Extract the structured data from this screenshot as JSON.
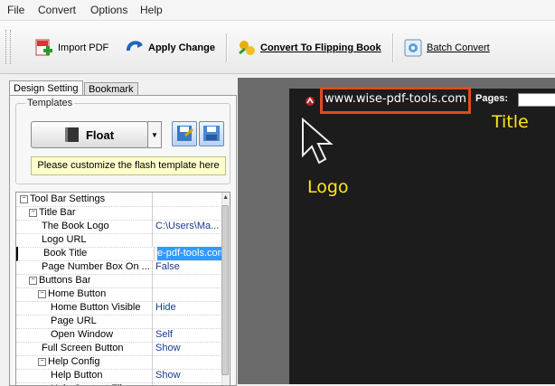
{
  "menu": [
    "File",
    "Convert",
    "Options",
    "Help"
  ],
  "toolbar": {
    "import_label": "Import PDF",
    "apply_label": "Apply Change",
    "convert_label": "Convert To Flipping Book",
    "batch_label": "Batch Convert"
  },
  "tabs": [
    "Design Setting",
    "Bookmark"
  ],
  "templates": {
    "group_label": "Templates",
    "selected": "Float",
    "hint": "Please customize the flash template here"
  },
  "property_grid": [
    {
      "name": "Tool Bar Settings",
      "indent": 0,
      "group": true,
      "value": ""
    },
    {
      "name": "Title Bar",
      "indent": 1,
      "group": true,
      "value": ""
    },
    {
      "name": "The Book Logo",
      "indent": 2,
      "group": false,
      "value": "C:\\Users\\Ma..."
    },
    {
      "name": "Logo URL",
      "indent": 2,
      "group": false,
      "value": ""
    },
    {
      "name": "Book Title",
      "indent": 2,
      "group": false,
      "value": "e-pdf-tools.com",
      "selected": true
    },
    {
      "name": "Page Number Box On ...",
      "indent": 2,
      "group": false,
      "value": "False"
    },
    {
      "name": "Buttons Bar",
      "indent": 1,
      "group": true,
      "value": ""
    },
    {
      "name": "Home Button",
      "indent": 2,
      "group": true,
      "value": ""
    },
    {
      "name": "Home Button Visible",
      "indent": 3,
      "group": false,
      "value": "Hide"
    },
    {
      "name": "Page URL",
      "indent": 3,
      "group": false,
      "value": ""
    },
    {
      "name": "Open Window",
      "indent": 3,
      "group": false,
      "value": "Self"
    },
    {
      "name": "Full Screen Button",
      "indent": 2,
      "group": false,
      "value": "Show"
    },
    {
      "name": "Help Config",
      "indent": 2,
      "group": true,
      "value": ""
    },
    {
      "name": "Help Button",
      "indent": 3,
      "group": false,
      "value": "Show"
    },
    {
      "name": "Help Content File",
      "indent": 3,
      "group": false,
      "value": ""
    }
  ],
  "preview": {
    "url_text": "www.wise-pdf-tools.com",
    "pages_label": "Pages:",
    "title_annotation": "Title",
    "logo_annotation": "Logo"
  },
  "colors": {
    "highlight_box": "#e04b1f",
    "annotation_yellow": "#ffe61a",
    "selection_blue": "#3399ff"
  }
}
